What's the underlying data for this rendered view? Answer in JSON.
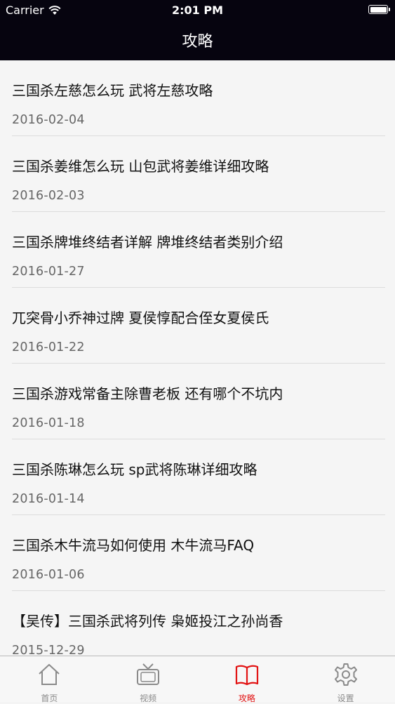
{
  "status_bar": {
    "carrier": "Carrier",
    "time": "2:01 PM",
    "battery_level": 1.0
  },
  "nav": {
    "title": "攻略"
  },
  "articles": [
    {
      "title": "三国杀左慈怎么玩 武将左慈攻略",
      "date": "2016-02-04"
    },
    {
      "title": "三国杀姜维怎么玩 山包武将姜维详细攻略",
      "date": "2016-02-03"
    },
    {
      "title": "三国杀牌堆终结者详解 牌堆终结者类别介绍",
      "date": "2016-01-27"
    },
    {
      "title": "兀突骨小乔神过牌 夏侯惇配合侄女夏侯氏",
      "date": "2016-01-22"
    },
    {
      "title": "三国杀游戏常备主除曹老板 还有哪个不坑内",
      "date": "2016-01-18"
    },
    {
      "title": "三国杀陈琳怎么玩 sp武将陈琳详细攻略",
      "date": "2016-01-14"
    },
    {
      "title": "三国杀木牛流马如何使用 木牛流马FAQ",
      "date": "2016-01-06"
    },
    {
      "title": "【吴传】三国杀武将列传 枭姬投江之孙尚香",
      "date": "2015-12-29"
    }
  ],
  "tabs": [
    {
      "label": "首页",
      "icon": "home-icon",
      "active": false
    },
    {
      "label": "视频",
      "icon": "tv-icon",
      "active": false
    },
    {
      "label": "攻略",
      "icon": "book-icon",
      "active": true
    },
    {
      "label": "设置",
      "icon": "gear-icon",
      "active": false
    }
  ],
  "colors": {
    "nav_background": "#06040f",
    "active_tab": "#e21313",
    "inactive_tab": "#8a8a8a"
  }
}
